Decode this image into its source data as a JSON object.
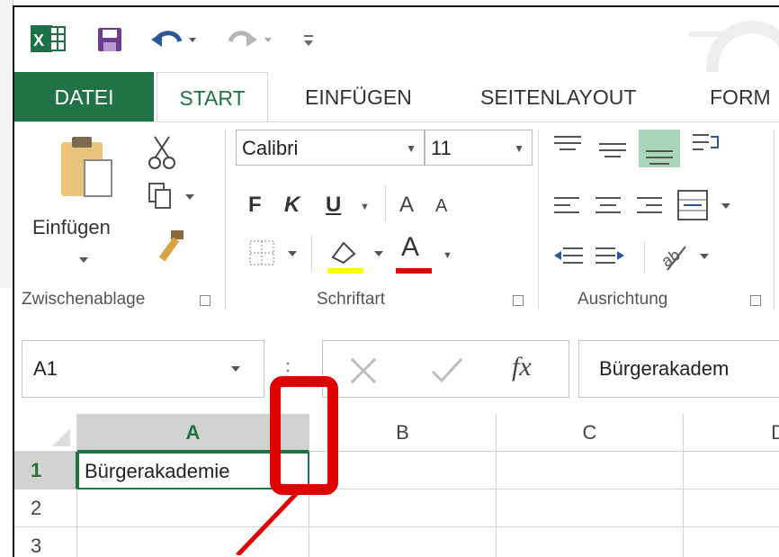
{
  "qat": {
    "excel_icon": "excel-logo-icon",
    "save_icon": "save-icon",
    "undo_icon": "undo-icon",
    "redo_icon": "redo-icon",
    "customize_icon": "customize-qat-icon"
  },
  "tabs": [
    {
      "label": "DATEI"
    },
    {
      "label": "START"
    },
    {
      "label": "EINFÜGEN"
    },
    {
      "label": "SEITENLAYOUT"
    },
    {
      "label": "FORM"
    }
  ],
  "clipboard": {
    "paste_label": "Einfügen",
    "group_label": "Zwischenablage"
  },
  "font": {
    "name": "Calibri",
    "size": "11",
    "bold": "F",
    "italic": "K",
    "underline": "U",
    "grow": "A",
    "shrink": "A",
    "color_glyph": "A",
    "fill_color": "#ffff00",
    "font_color": "#e00000",
    "group_label": "Schriftart"
  },
  "alignment": {
    "group_label": "Ausrichtung"
  },
  "formula_bar": {
    "name_box": "A1",
    "fx": "fx",
    "content": "Bürgerakadem"
  },
  "grid": {
    "columns": [
      "A",
      "B",
      "C",
      "D"
    ],
    "rows": [
      "1",
      "2",
      "3"
    ],
    "cell_a1": "Bürgerakademie"
  },
  "colors": {
    "accent": "#217346",
    "highlight": "#e00000"
  }
}
